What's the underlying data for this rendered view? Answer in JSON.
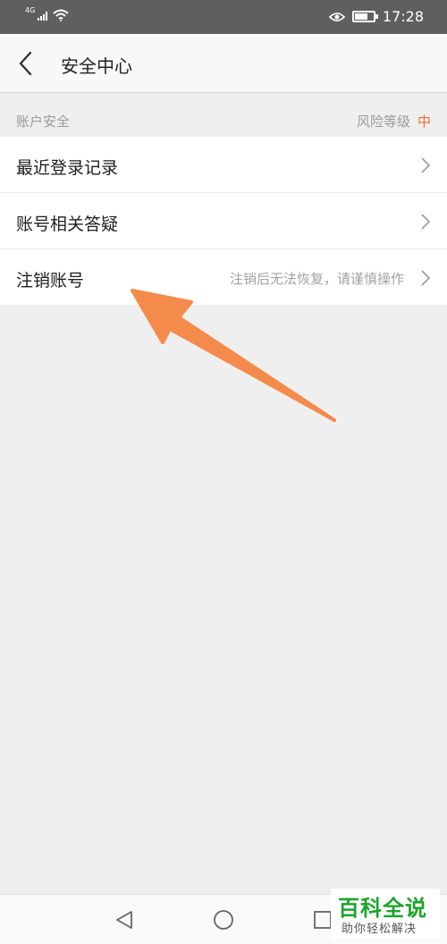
{
  "status_bar": {
    "network": "4G",
    "time": "17:28",
    "battery_level": 0.7
  },
  "header": {
    "title": "安全中心",
    "back_icon": "chevron-left-icon"
  },
  "section": {
    "title": "账户安全",
    "risk_label": "风险等级",
    "risk_value": "中",
    "risk_color": "#e8702a"
  },
  "items": [
    {
      "label": "最近登录记录",
      "hint": ""
    },
    {
      "label": "账号相关答疑",
      "hint": ""
    },
    {
      "label": "注销账号",
      "hint": "注销后无法恢复，请谨慎操作"
    }
  ],
  "annotation": {
    "icon": "pointer-arrow-icon",
    "color": "#f48b4c"
  },
  "nav": {
    "icons": [
      "back-triangle-icon",
      "home-circle-icon",
      "recents-square-icon"
    ]
  },
  "watermark": {
    "title": "百科全说",
    "subtitle": "助你轻松解决",
    "color": "#1aa52a"
  }
}
